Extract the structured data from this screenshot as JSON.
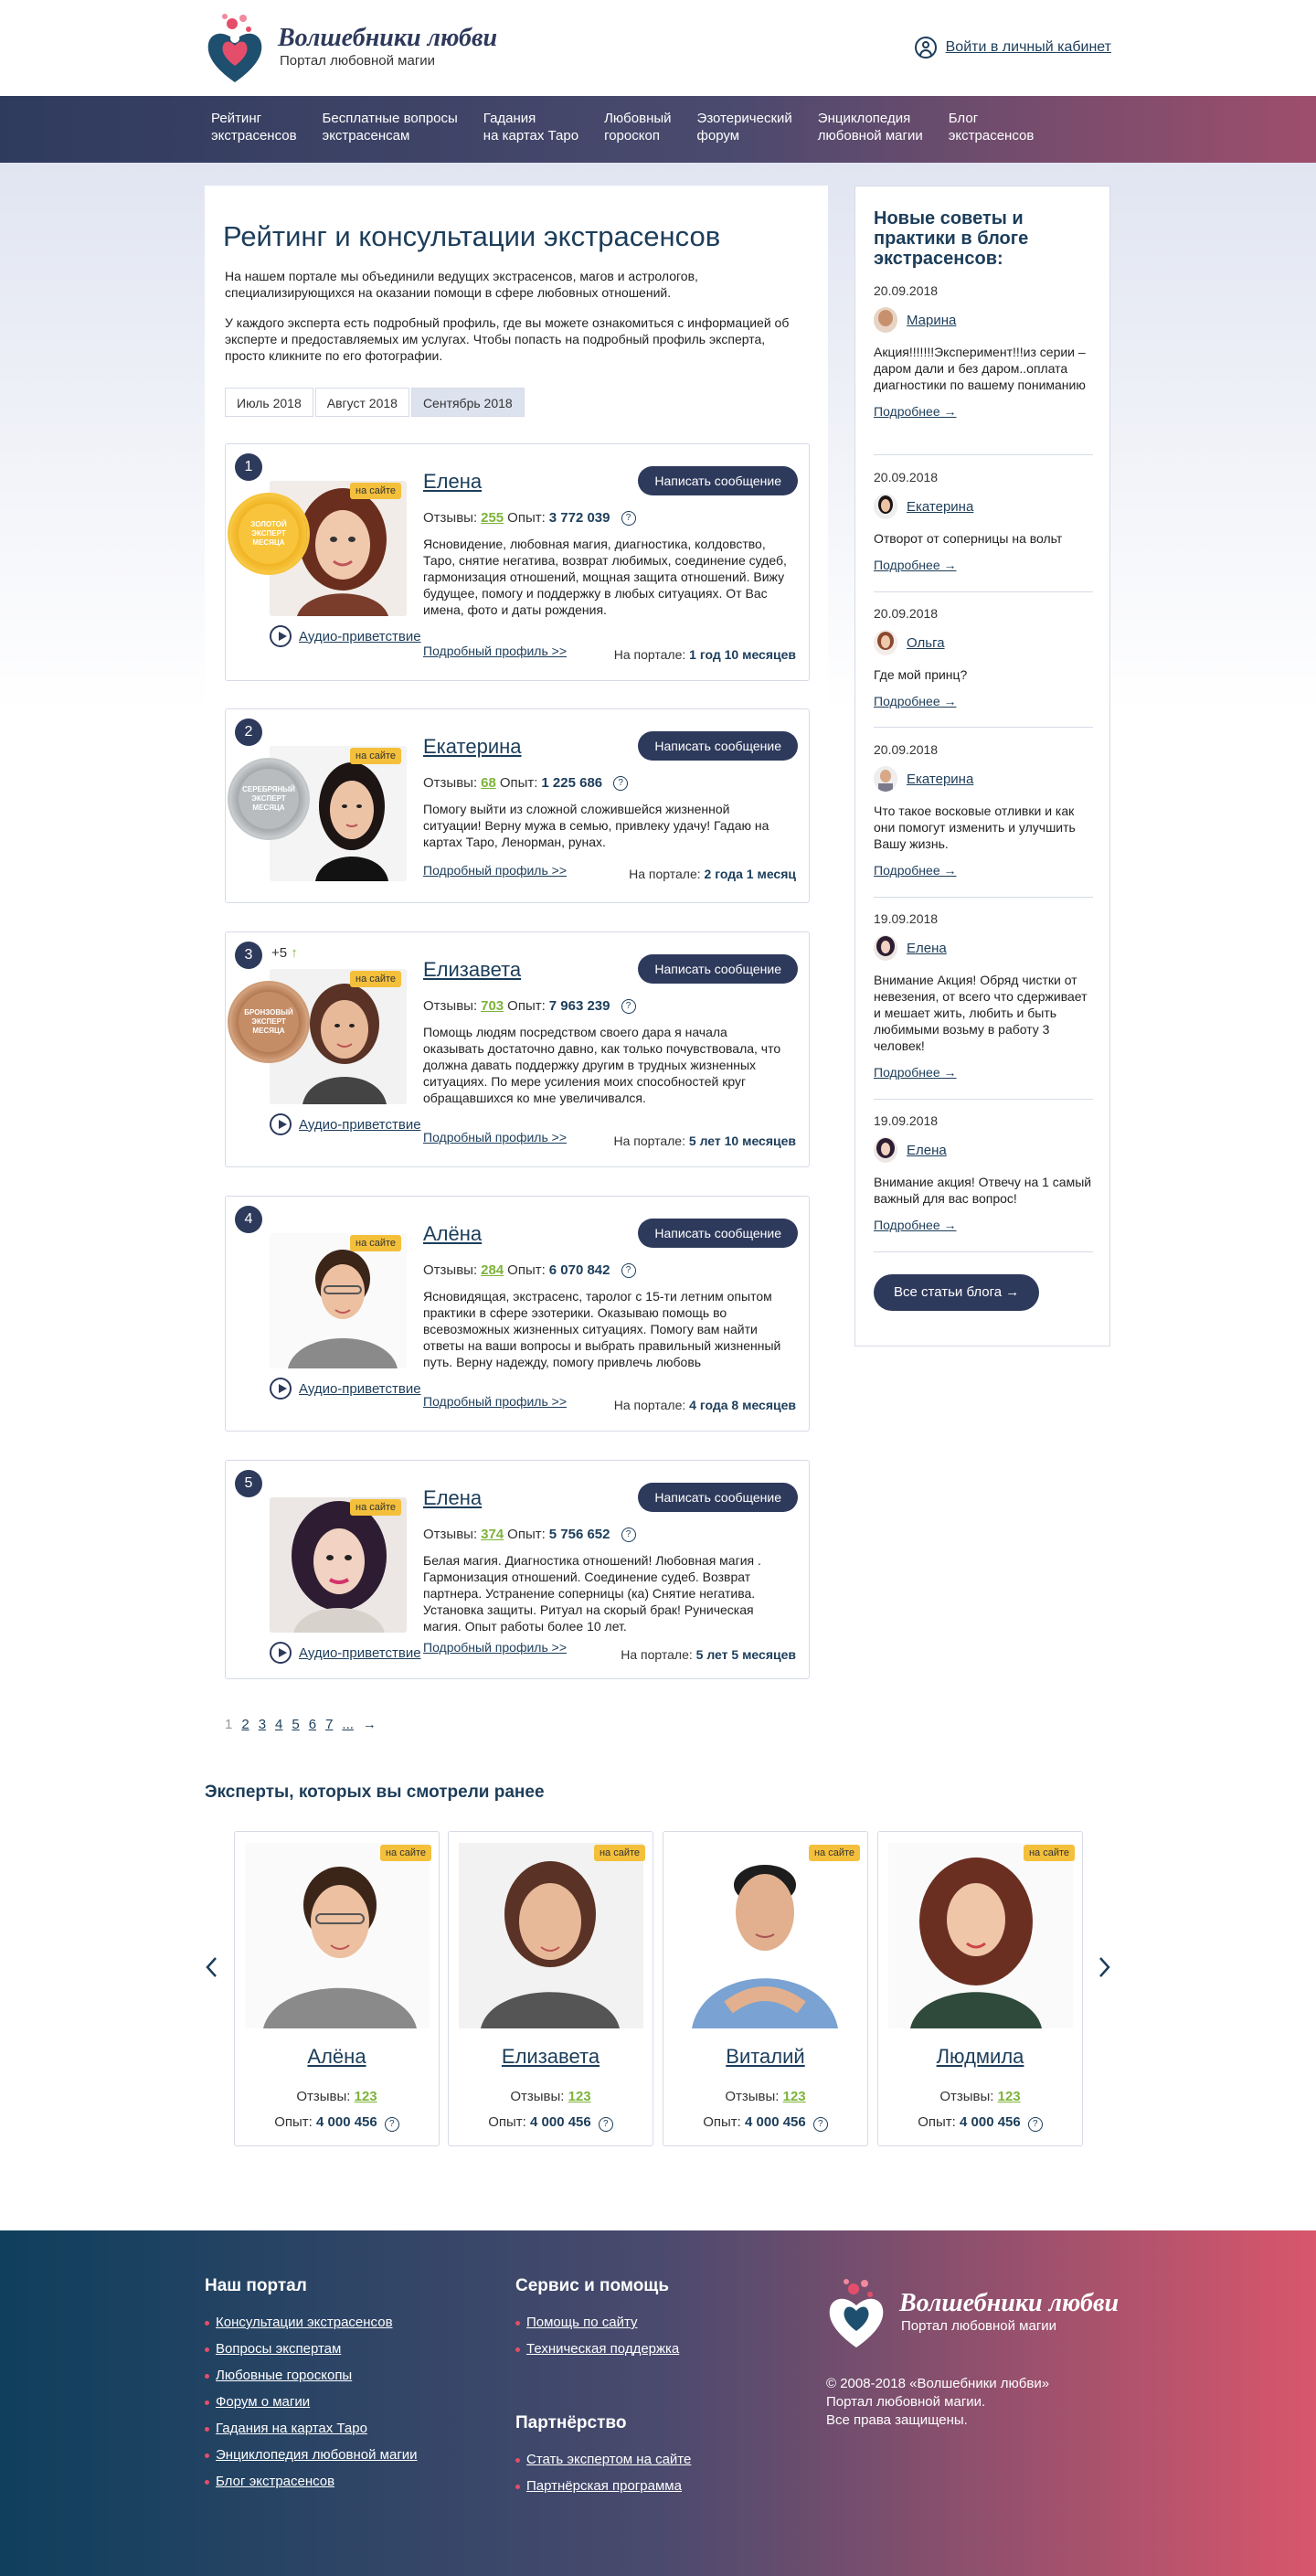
{
  "header": {
    "logo_title": "Волшебники любви",
    "logo_sub": "Портал любовной магии",
    "login": "Войти в личный кабинет"
  },
  "nav": [
    "Рейтинг\nэкстрасенсов",
    "Бесплатные вопросы\nэкстрасенсам",
    "Гадания\nна картах Таро",
    "Любовный\nгороскоп",
    "Эзотерический\nфорум",
    "Энциклопедия\nлюбовной магии",
    "Блог\nэкстрасенсов"
  ],
  "main": {
    "title": "Рейтинг и консультации экстрасенсов",
    "intro1": "На нашем портале мы объединили ведущих экстрасенсов, магов и астрологов, специализирующихся на оказании помощи в сфере любовных отношений.",
    "intro2": "У каждого эксперта есть подробный профиль, где вы можете ознакомиться с информацией об эксперте и предоставляемых им услугах. Чтобы попасть на подробный профиль эксперта, просто кликните по его фотографии.",
    "months": [
      "Июль 2018",
      "Август 2018",
      "Сентябрь 2018"
    ],
    "online": "на сайте",
    "write": "Написать сообщение",
    "reviews_label": "Отзывы:",
    "exp_label": "Опыт:",
    "audio": "Аудио-приветствие",
    "profile": "Подробный профиль >>",
    "tenure_label": "На портале:",
    "experts": [
      {
        "rank": "1",
        "name": "Елена",
        "reviews": "255",
        "exp": "3 772 039",
        "medal": "золотой эксперт месяца",
        "desc": "Ясновидение, любовная магия, диагностика, колдовство, Таро, снятие негатива, возврат любимых, соединение судеб, гармонизация отношений, мощная защита отношений. Вижу будущее, помогу и поддержку в любых ситуациях. От Вас имена, фото и даты рождения.",
        "tenure": "1 год 10 месяцев"
      },
      {
        "rank": "2",
        "name": "Екатерина",
        "reviews": "68",
        "exp": "1 225 686",
        "medal": "серебряный эксперт месяца",
        "desc": "Помогу выйти из сложной сложившейся жизненной ситуации! Верну мужа в семью, привлеку удачу! Гадаю на картах Таро, Ленорман, рунах.",
        "tenure": "2 года 1 месяц"
      },
      {
        "rank": "3",
        "delta": "+5",
        "arrow": "↑",
        "name": "Елизавета",
        "reviews": "703",
        "exp": "7 963 239",
        "medal": "бронзовый эксперт месяца",
        "desc": "Помощь людям посредством своего дара я начала оказывать достаточно давно, как только почувствовала, что должна давать поддержку другим в трудных жизненных ситуациях. По мере усиления моих способностей круг обращавшихся ко мне увеличивался.",
        "tenure": "5 лет 10 месяцев"
      },
      {
        "rank": "4",
        "name": "Алёна",
        "reviews": "284",
        "exp": "6 070 842",
        "desc": "Ясновидящая, экстрасенс, таролог с 15-ти летним опытом практики в сфере эзотерики. Оказываю помощь во всевозможных жизненных ситуациях. Помогу вам найти ответы на ваши вопросы и выбрать правильный жизненный путь. Верну надежду, помогу привлечь любовь",
        "tenure": "4 года 8 месяцев"
      },
      {
        "rank": "5",
        "name": "Елена",
        "reviews": "374",
        "exp": "5 756 652",
        "desc": "Белая магия. Диагностика отношений! Любовная магия . Гармонизация отношений. Соединение судеб. Возврат партнера. Устранение соперницы (ка) Снятие негатива. Установка защиты. Ритуал на скорый брак! Руническая магия. Опыт работы более 10 лет.",
        "tenure": "5 лет 5 месяцев"
      }
    ],
    "pages": [
      "1",
      "2",
      "3",
      "4",
      "5",
      "6",
      "7",
      "...",
      "→"
    ]
  },
  "sidebar": {
    "title": "Новые советы и практики в блоге экстрасенсов:",
    "more": "Подробнее →",
    "posts": [
      {
        "date": "20.09.2018",
        "author": "Марина",
        "text": "Акция!!!!!!!Эксперимент!!!из серии –даром дали и без даром..оплата диагностики по вашему пониманию"
      },
      {
        "date": "20.09.2018",
        "author": "Екатерина",
        "text": "Отворот от соперницы на вольт"
      },
      {
        "date": "20.09.2018",
        "author": "Ольга",
        "text": "Где мой принц?"
      },
      {
        "date": "20.09.2018",
        "author": "Екатерина",
        "text": "Что такое восковые отливки и как они помогут изменить и улучшить Вашу жизнь."
      },
      {
        "date": "19.09.2018",
        "author": "Елена",
        "text": "Внимание Акция! Обряд чистки от невезения, от всего что сдерживает и мешает жить, любить и быть любимыми возьму в работу 3 человек!"
      },
      {
        "date": "19.09.2018",
        "author": "Елена",
        "text": "Внимание акция! Отвечу на 1 самый важный для вас вопрос!"
      }
    ],
    "all": "Все статьи блога →"
  },
  "recent": {
    "title": "Эксперты, которых вы смотрели ранее",
    "online": "на сайте",
    "reviews_label": "Отзывы:",
    "exp_label": "Опыт:",
    "items": [
      {
        "name": "Алёна",
        "reviews": "123",
        "exp": "4 000 456"
      },
      {
        "name": "Елизавета",
        "reviews": "123",
        "exp": "4 000 456"
      },
      {
        "name": "Виталий",
        "reviews": "123",
        "exp": "4 000 456"
      },
      {
        "name": "Людмила",
        "reviews": "123",
        "exp": "4 000 456"
      }
    ]
  },
  "footer": {
    "col1_title": "Наш портал",
    "col1": [
      "Консультации экстрасенсов",
      "Вопросы экспертам",
      "Любовные гороскопы",
      "Форум о магии",
      "Гадания на картах Таро",
      "Энциклопедия любовной магии",
      "Блог экстрасенсов"
    ],
    "col2_title": "Сервис и помощь",
    "col2": [
      "Помощь по сайту",
      "Техническая поддержка"
    ],
    "col3_title": "Партнёрство",
    "col3": [
      "Стать экспертом на сайте",
      "Партнёрская программа"
    ],
    "logo_title": "Волшебники любви",
    "logo_sub": "Портал любовной магии",
    "copyright": "© 2008-2018 «Волшебники любви»\nПортал любовной магии.\nВсе права защищены."
  },
  "colors": {
    "navy": "#2e3a5c",
    "link": "#1c3d5a",
    "green": "#7db33a",
    "badge": "#f4c03b",
    "accent": "#e54e6a"
  }
}
